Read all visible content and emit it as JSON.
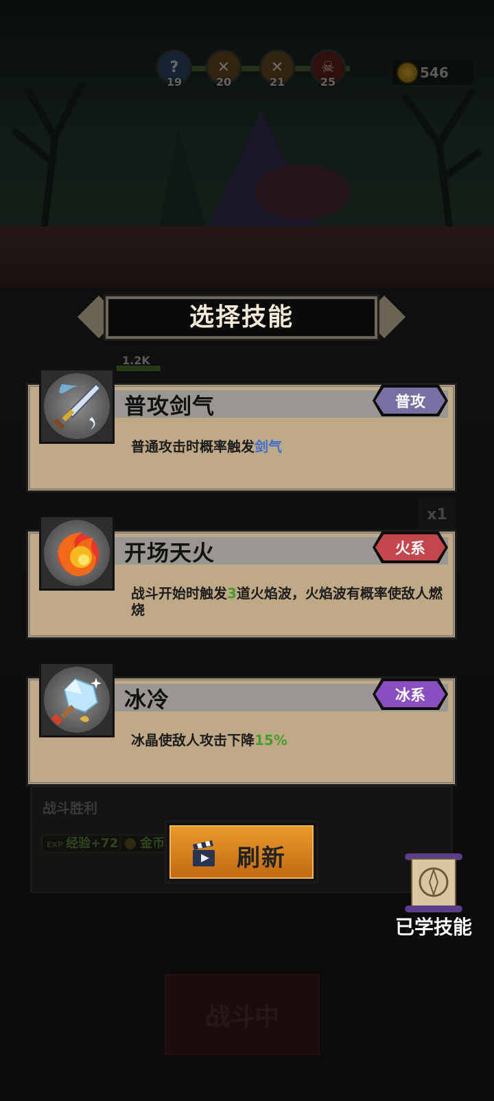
{
  "hud": {
    "stages": [
      {
        "glyph": "?",
        "num": "19",
        "color": "#24364f"
      },
      {
        "glyph": "✕",
        "num": "20",
        "color": "#4e3a1a"
      },
      {
        "glyph": "✕",
        "num": "21",
        "color": "#4e3a1a"
      },
      {
        "glyph": "☠",
        "num": "25",
        "color": "#4a1a14"
      }
    ],
    "coins": "546"
  },
  "battle": {
    "hp_label": "1.2K",
    "speed": "x1",
    "result_title": "战斗胜利",
    "reward_exp_tag": "EXP",
    "reward_exp": "经验+72",
    "reward_gold": "金币",
    "battle_button": "战斗中"
  },
  "dialog": {
    "title": "选择技能",
    "skills": [
      {
        "name": "普攻剑气",
        "tag": "普攻",
        "tag_color": "#7a6fa2",
        "desc_before": "普通攻击时概率触发",
        "desc_highlight": "剑气",
        "desc_after": "",
        "icon": "sword-icon"
      },
      {
        "name": "开场天火",
        "tag": "火系",
        "tag_color": "#c2464c",
        "desc_before": "战斗开始时触发",
        "desc_highlight": "3",
        "desc_after": "道火焰波，火焰波有概率使敌人燃烧",
        "icon": "fire-icon"
      },
      {
        "name": "冰冷",
        "tag": "冰系",
        "tag_color": "#8a4ec0",
        "desc_before": "冰晶使敌人攻击下降",
        "desc_highlight": "15%",
        "desc_after": "",
        "icon": "ice-sword-icon"
      }
    ],
    "refresh_label": "刷新",
    "learned_label": "已学技能"
  }
}
